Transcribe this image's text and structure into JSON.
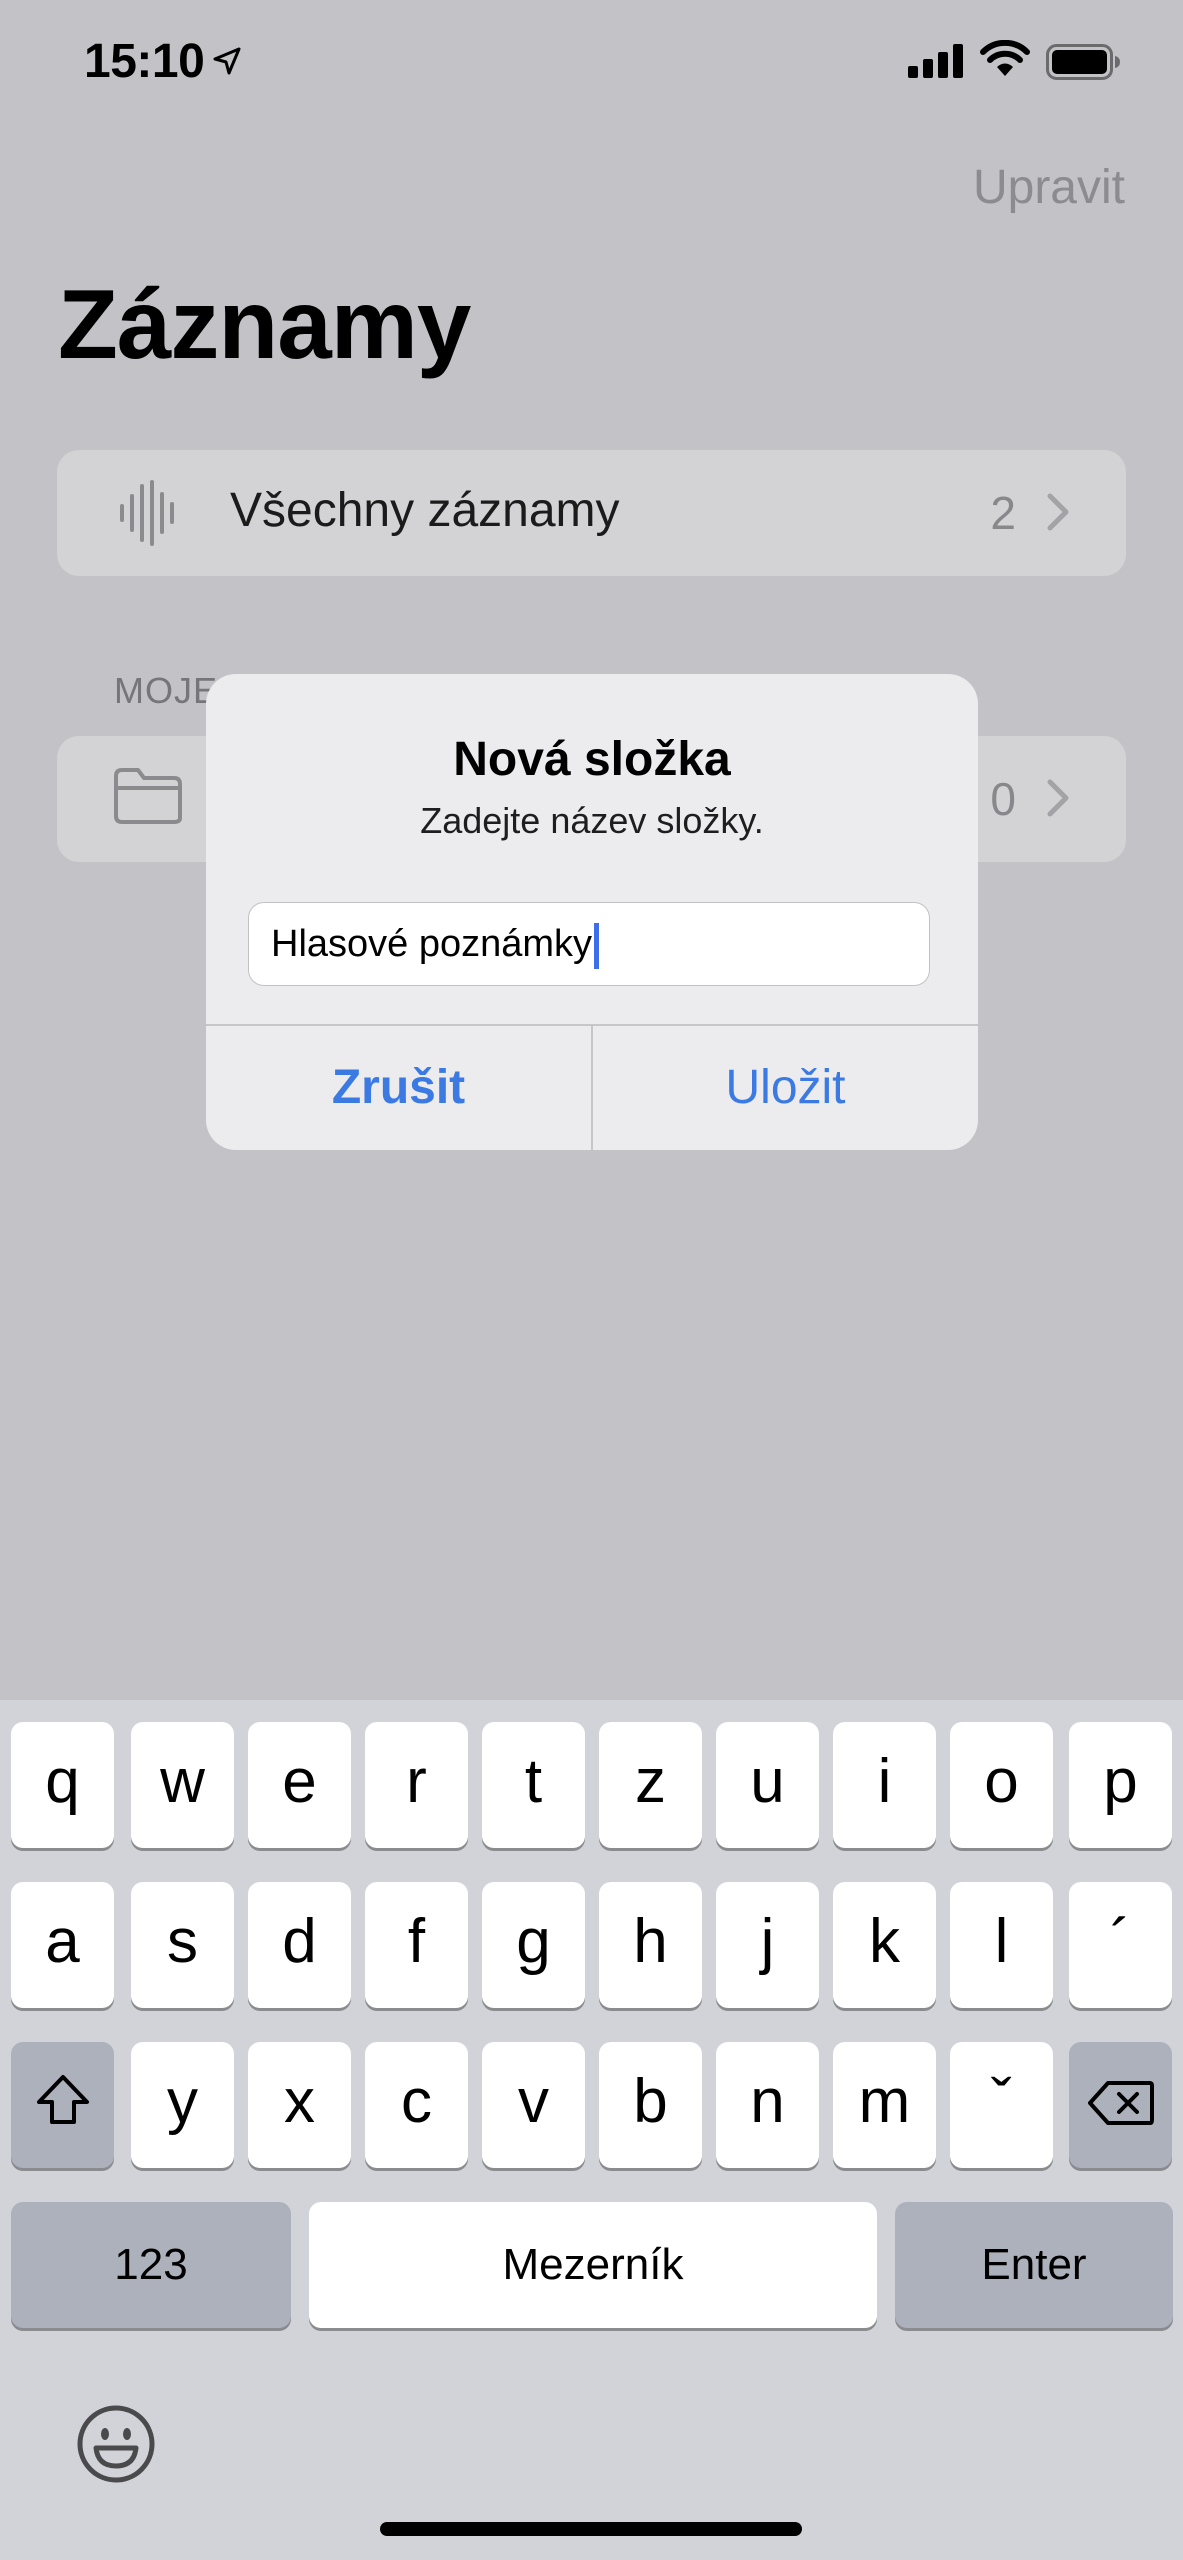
{
  "status_bar": {
    "time": "15:10"
  },
  "header": {
    "edit_label": "Upravit",
    "title": "Záznamy"
  },
  "all_recordings": {
    "label": "Všechny záznamy",
    "count": "2"
  },
  "folders_section": {
    "header": "MOJE SLOŽKY",
    "visible_header": "MOJE",
    "folder_count": "0"
  },
  "dialog": {
    "title": "Nová složka",
    "message": "Zadejte název složky.",
    "input_value": "Hlasové poznámky",
    "cancel_label": "Zrušit",
    "save_label": "Uložit"
  },
  "keyboard": {
    "row1": [
      "q",
      "w",
      "e",
      "r",
      "t",
      "z",
      "u",
      "i",
      "o",
      "p"
    ],
    "row2": [
      "a",
      "s",
      "d",
      "f",
      "g",
      "h",
      "j",
      "k",
      "l",
      "´"
    ],
    "row3": [
      "y",
      "x",
      "c",
      "v",
      "b",
      "n",
      "m",
      "ˇ"
    ],
    "numbers_label": "123",
    "space_label": "Mezerník",
    "return_label": "Enter"
  },
  "colors": {
    "accent": "#3a7ae2",
    "dim_background": "#c3c3c7",
    "keyboard_background": "#d2d3d9"
  }
}
